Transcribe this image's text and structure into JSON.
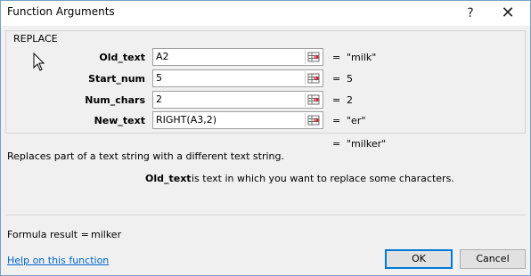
{
  "window": {
    "title": "Function Arguments",
    "help_glyph": "?",
    "close_glyph": "✕"
  },
  "function": {
    "name": "REPLACE",
    "description": "Replaces part of a text string with a different text string.",
    "current_arg_name": "Old_text",
    "current_arg_description": "is text in which you want to replace some characters.",
    "result_equals": "=",
    "result_preview": "\"milker\""
  },
  "args": [
    {
      "label": "Old_text",
      "value": "A2",
      "equals": "=",
      "evaluated": "\"milk\""
    },
    {
      "label": "Start_num",
      "value": "5",
      "equals": "=",
      "evaluated": "5"
    },
    {
      "label": "Num_chars",
      "value": "2",
      "equals": "=",
      "evaluated": "2"
    },
    {
      "label": "New_text",
      "value": "RIGHT(A3,2)",
      "equals": "=",
      "evaluated": "\"er\""
    }
  ],
  "footer": {
    "formula_result_label": "Formula result =",
    "formula_result_value": "milker",
    "help_link": "Help on this function",
    "ok_label": "OK",
    "cancel_label": "Cancel"
  },
  "colors": {
    "accent": "#0078d7",
    "link": "#0066cc"
  },
  "icons": {
    "collapse": "range-select-icon",
    "cursor": "mouse-pointer-icon"
  }
}
